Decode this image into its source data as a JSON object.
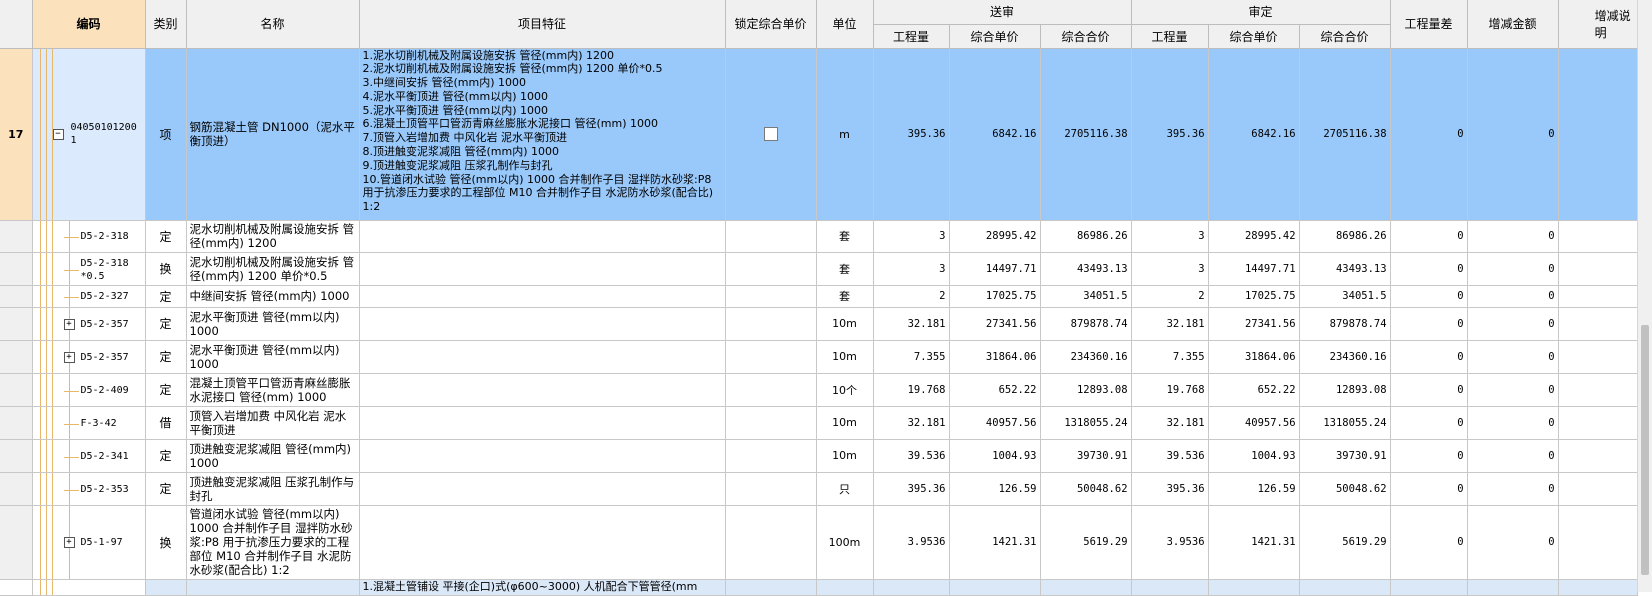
{
  "header": {
    "code": "编码",
    "type": "类别",
    "name": "名称",
    "features": "项目特征",
    "lock": "锁定综合单价",
    "unit": "单位",
    "submit_group": "送审",
    "review_group": "审定",
    "qty": "工程量",
    "unit_price": "综合单价",
    "total": "综合合价",
    "qty_diff": "工程量差",
    "amount_diff": "增减金额",
    "note": "增减说明"
  },
  "main_row": {
    "row_num": "17",
    "code": "040501012001",
    "type": "项",
    "name": "钢筋混凝土管 DN1000（泥水平衡顶进）",
    "features": "1.泥水切削机械及附属设施安拆 管径(mm内) 1200\n2.泥水切削机械及附属设施安拆 管径(mm内) 1200  单价*0.5\n3.中继间安拆 管径(mm内) 1000\n4.泥水平衡顶进 管径(mm以内) 1000\n5.泥水平衡顶进 管径(mm以内) 1000\n6.混凝土顶管平口管沥青麻丝膨胀水泥接口 管径(mm) 1000\n7.顶管入岩增加费 中风化岩 泥水平衡顶进\n8.顶进触变泥浆减阻 管径(mm内) 1000\n9.顶进触变泥浆减阻 压浆孔制作与封孔\n10.管道闭水试验 管径(mm以内) 1000  合并制作子目 湿拌防水砂浆:P8 用于抗渗压力要求的工程部位 M10  合并制作子目 水泥防水砂浆(配合比) 1:2",
    "unit": "m",
    "qty": "395.36",
    "unit_price": "6842.16",
    "total": "2705116.38",
    "rev_qty": "395.36",
    "rev_unit_price": "6842.16",
    "rev_total": "2705116.38",
    "qty_diff": "0",
    "amount_diff": "0",
    "expander": "−"
  },
  "rows": [
    {
      "code": "D5-2-318",
      "type": "定",
      "name": "泥水切削机械及附属设施安拆 管径(mm内) 1200",
      "unit": "套",
      "qty": "3",
      "unit_price": "28995.42",
      "total": "86986.26",
      "rev_qty": "3",
      "rev_unit_price": "28995.42",
      "rev_total": "86986.26",
      "qty_diff": "0",
      "amount_diff": "0",
      "expander": ""
    },
    {
      "code": "D5-2-318 *0.5",
      "type": "换",
      "name": "泥水切削机械及附属设施安拆 管径(mm内) 1200  单价*0.5",
      "unit": "套",
      "qty": "3",
      "unit_price": "14497.71",
      "total": "43493.13",
      "rev_qty": "3",
      "rev_unit_price": "14497.71",
      "rev_total": "43493.13",
      "qty_diff": "0",
      "amount_diff": "0",
      "expander": ""
    },
    {
      "code": "D5-2-327",
      "type": "定",
      "name": "中继间安拆 管径(mm内) 1000",
      "unit": "套",
      "qty": "2",
      "unit_price": "17025.75",
      "total": "34051.5",
      "rev_qty": "2",
      "rev_unit_price": "17025.75",
      "rev_total": "34051.5",
      "qty_diff": "0",
      "amount_diff": "0",
      "expander": ""
    },
    {
      "code": "D5-2-357",
      "type": "定",
      "name": "泥水平衡顶进 管径(mm以内) 1000",
      "unit": "10m",
      "qty": "32.181",
      "unit_price": "27341.56",
      "total": "879878.74",
      "rev_qty": "32.181",
      "rev_unit_price": "27341.56",
      "rev_total": "879878.74",
      "qty_diff": "0",
      "amount_diff": "0",
      "expander": "+"
    },
    {
      "code": "D5-2-357",
      "type": "定",
      "name": "泥水平衡顶进 管径(mm以内) 1000",
      "unit": "10m",
      "qty": "7.355",
      "unit_price": "31864.06",
      "total": "234360.16",
      "rev_qty": "7.355",
      "rev_unit_price": "31864.06",
      "rev_total": "234360.16",
      "qty_diff": "0",
      "amount_diff": "0",
      "expander": "+"
    },
    {
      "code": "D5-2-409",
      "type": "定",
      "name": "混凝土顶管平口管沥青麻丝膨胀水泥接口 管径(mm) 1000",
      "unit": "10个",
      "qty": "19.768",
      "unit_price": "652.22",
      "total": "12893.08",
      "rev_qty": "19.768",
      "rev_unit_price": "652.22",
      "rev_total": "12893.08",
      "qty_diff": "0",
      "amount_diff": "0",
      "expander": ""
    },
    {
      "code": "F-3-42",
      "type": "借",
      "name": "顶管入岩增加费 中风化岩 泥水平衡顶进",
      "unit": "10m",
      "qty": "32.181",
      "unit_price": "40957.56",
      "total": "1318055.24",
      "rev_qty": "32.181",
      "rev_unit_price": "40957.56",
      "rev_total": "1318055.24",
      "qty_diff": "0",
      "amount_diff": "0",
      "expander": ""
    },
    {
      "code": "D5-2-341",
      "type": "定",
      "name": "顶进触变泥浆减阻 管径(mm内) 1000",
      "unit": "10m",
      "qty": "39.536",
      "unit_price": "1004.93",
      "total": "39730.91",
      "rev_qty": "39.536",
      "rev_unit_price": "1004.93",
      "rev_total": "39730.91",
      "qty_diff": "0",
      "amount_diff": "0",
      "expander": ""
    },
    {
      "code": "D5-2-353",
      "type": "定",
      "name": "顶进触变泥浆减阻 压浆孔制作与封孔",
      "unit": "只",
      "qty": "395.36",
      "unit_price": "126.59",
      "total": "50048.62",
      "rev_qty": "395.36",
      "rev_unit_price": "126.59",
      "rev_total": "50048.62",
      "qty_diff": "0",
      "amount_diff": "0",
      "expander": ""
    },
    {
      "code": "D5-1-97",
      "type": "换",
      "name": "管道闭水试验 管径(mm以内) 1000  合并制作子目 湿拌防水砂浆:P8 用于抗渗压力要求的工程部位 M10  合并制作子目 水泥防水砂浆(配合比) 1:2",
      "unit": "100m",
      "qty": "3.9536",
      "unit_price": "1421.31",
      "total": "5619.29",
      "rev_qty": "3.9536",
      "rev_unit_price": "1421.31",
      "rev_total": "5619.29",
      "qty_diff": "0",
      "amount_diff": "0",
      "expander": "+"
    }
  ],
  "next_row": {
    "features": "1.混凝土管铺设 平接(企口)式(φ600~3000) 人机配合下管管径(mm"
  }
}
